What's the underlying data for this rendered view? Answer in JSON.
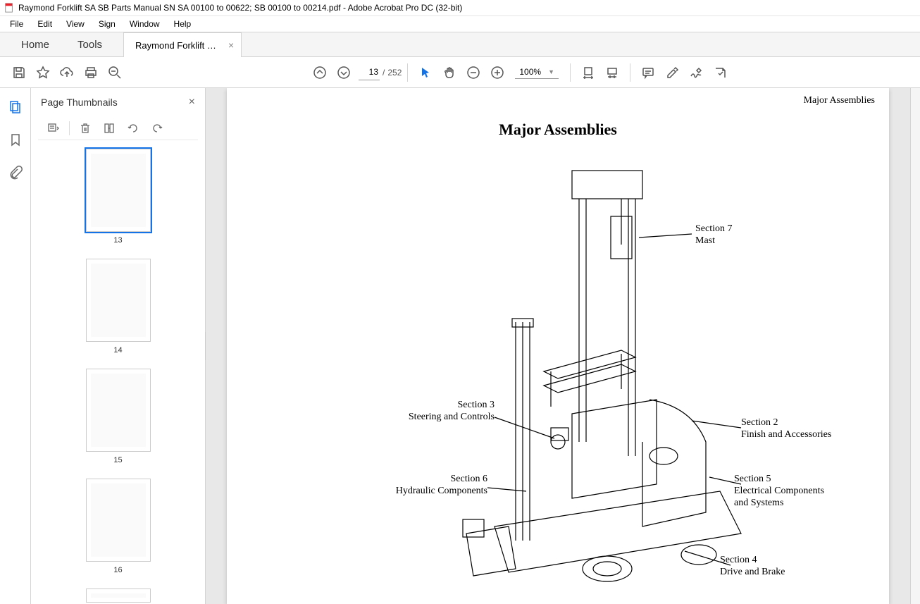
{
  "window": {
    "title": "Raymond Forklift SA SB Parts Manual SN SA 00100 to 00622; SB 00100 to 00214.pdf - Adobe Acrobat Pro DC (32-bit)"
  },
  "menubar": {
    "items": [
      "File",
      "Edit",
      "View",
      "Sign",
      "Window",
      "Help"
    ]
  },
  "tabbar": {
    "home": "Home",
    "tools": "Tools",
    "doc_tab": "Raymond Forklift S..."
  },
  "toolbar": {
    "current_page": "13",
    "page_sep": "/",
    "total_pages": "252",
    "zoom": "100%"
  },
  "thumbnails": {
    "title": "Page Thumbnails",
    "items": [
      {
        "num": "13",
        "selected": true
      },
      {
        "num": "14",
        "selected": false
      },
      {
        "num": "15",
        "selected": false
      },
      {
        "num": "16",
        "selected": false
      }
    ]
  },
  "document": {
    "running_header": "Major Assemblies",
    "page_title": "Major Assemblies",
    "callouts": {
      "sec7_line1": "Section 7",
      "sec7_line2": "Mast",
      "sec3_line1": "Section 3",
      "sec3_line2": "Steering and Controls",
      "sec2_line1": "Section 2",
      "sec2_line2": "Finish and Accessories",
      "sec6_line1": "Section 6",
      "sec6_line2": "Hydraulic Components",
      "sec5_line1": "Section 5",
      "sec5_line2": "Electrical Components",
      "sec5_line3": "and Systems",
      "sec4_line1": "Section 4",
      "sec4_line2": "Drive and Brake"
    }
  }
}
